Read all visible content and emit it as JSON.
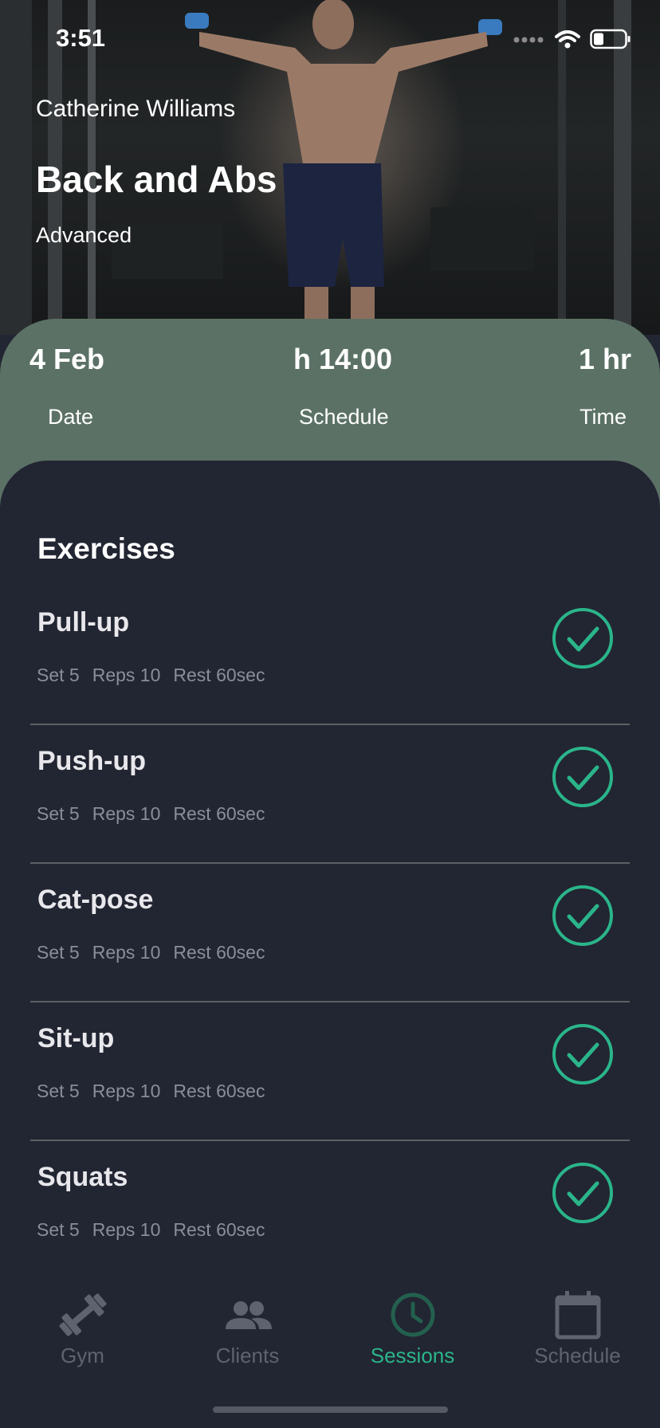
{
  "status_bar": {
    "time": "3:51"
  },
  "hero": {
    "user_name": "Catherine Williams",
    "title": "Back and Abs",
    "level": "Advanced"
  },
  "session_info": {
    "date_value": "4 Feb",
    "date_label": "Date",
    "schedule_value": "h 14:00",
    "schedule_label": "Schedule",
    "time_value": "1 hr",
    "time_label": "Time"
  },
  "exercises": {
    "title": "Exercises",
    "items": [
      {
        "name": "Pull-up",
        "set": "Set 5",
        "reps": "Reps 10",
        "rest": "Rest 60sec"
      },
      {
        "name": "Push-up",
        "set": "Set 5",
        "reps": "Reps 10",
        "rest": "Rest 60sec"
      },
      {
        "name": "Cat-pose",
        "set": "Set 5",
        "reps": "Reps 10",
        "rest": "Rest 60sec"
      },
      {
        "name": "Sit-up",
        "set": "Set 5",
        "reps": "Reps 10",
        "rest": "Rest 60sec"
      },
      {
        "name": "Squats",
        "set": "Set 5",
        "reps": "Reps 10",
        "rest": "Rest 60sec"
      }
    ]
  },
  "tabbar": {
    "tabs": [
      {
        "label": "Gym",
        "icon": "dumbbell-icon"
      },
      {
        "label": "Clients",
        "icon": "people-icon"
      },
      {
        "label": "Sessions",
        "icon": "clock-icon"
      },
      {
        "label": "Schedule",
        "icon": "calendar-icon"
      }
    ],
    "active": "Sessions"
  },
  "colors": {
    "accent": "#2ab58a",
    "panel": "#5b7165",
    "background": "#222532"
  }
}
